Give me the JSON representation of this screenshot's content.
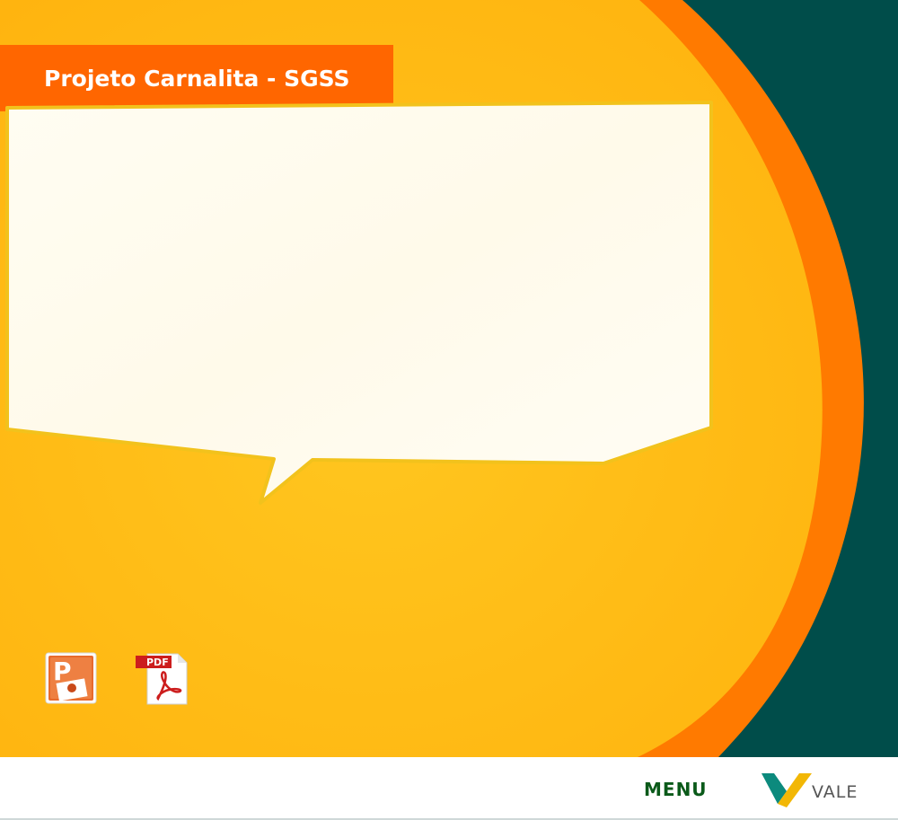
{
  "header": {
    "title": "Projeto Carnalita - SGSS"
  },
  "content": {
    "bubble_text": "",
    "icons": [
      {
        "name": "powerpoint-icon",
        "letter": "P"
      },
      {
        "name": "pdf-icon",
        "label": "PDF"
      }
    ]
  },
  "footer": {
    "menu_label": "MENU",
    "logo_text": "VALE"
  },
  "colors": {
    "accent_orange": "#ff6600",
    "background_yellow": "#ffb619",
    "dark_teal": "#004d4a",
    "menu_green": "#0b5a1a"
  }
}
